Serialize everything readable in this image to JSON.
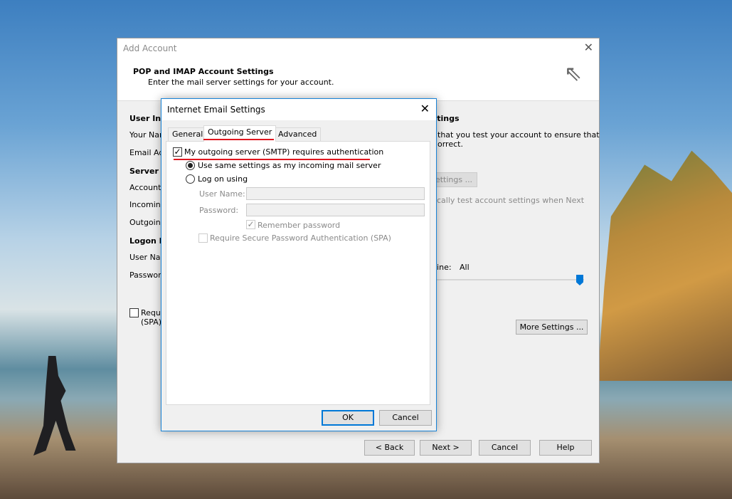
{
  "outer_dialog": {
    "title": "Add Account",
    "heading": "POP and IMAP Account Settings",
    "subheading": "Enter the mail server settings for your account.",
    "left_labels": [
      "User Info",
      "Your Nam",
      "Email Ad",
      "Server In",
      "Account",
      "Incoming",
      "Outgoin",
      "Logon In",
      "User Nam",
      "Password"
    ],
    "spa_label_1": "Requi",
    "spa_label_2": "(SPA)",
    "right_heading": "ttings",
    "right_text_1": "that you test your account to ensure that",
    "right_text_2": "orrect.",
    "test_button": "ettings ...",
    "auto_test_text": "cally test account settings when Next",
    "offline_label": "line:",
    "offline_value": "All",
    "offline_slider_percent": 100,
    "more_settings": "More Settings ...",
    "back": "< Back",
    "next": "Next >",
    "cancel": "Cancel",
    "help": "Help"
  },
  "inner_dialog": {
    "title": "Internet Email Settings",
    "tabs": [
      {
        "label": "General"
      },
      {
        "label": "Outgoing Server",
        "active": true
      },
      {
        "label": "Advanced"
      }
    ],
    "smtp_auth_label": "My outgoing server (SMTP) requires authentication",
    "smtp_auth_checked": true,
    "use_same_label": "Use same settings as my incoming mail server",
    "use_same_selected": true,
    "log_on_label": "Log on using",
    "user_name_label": "User Name:",
    "user_name_value": "",
    "password_label": "Password:",
    "password_value": "",
    "remember_label": "Remember password",
    "remember_checked": true,
    "spa_label": "Require Secure Password Authentication (SPA)",
    "spa_checked": false,
    "ok": "OK",
    "cancel": "Cancel"
  },
  "colors": {
    "accent": "#0078d7",
    "highlight": "#e0161e"
  }
}
